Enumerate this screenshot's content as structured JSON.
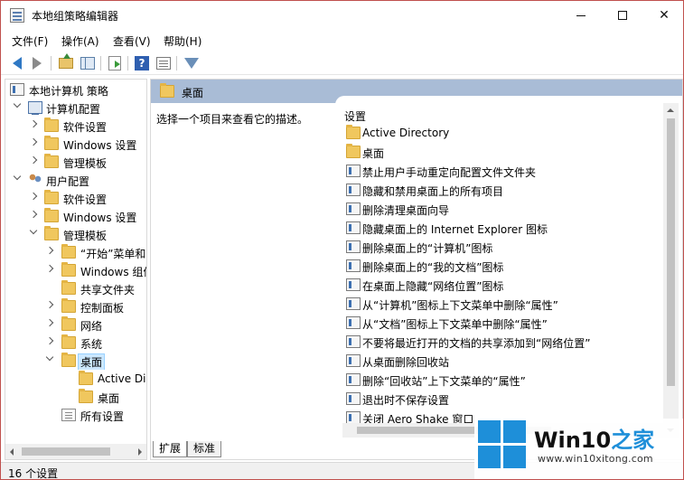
{
  "window": {
    "title": "本地组策略编辑器"
  },
  "menu": [
    "文件(F)",
    "操作(A)",
    "查看(V)",
    "帮助(H)"
  ],
  "tree": {
    "root": "本地计算机 策略",
    "computer_config": "计算机配置",
    "cc_children": [
      "软件设置",
      "Windows 设置",
      "管理模板"
    ],
    "user_config": "用户配置",
    "uc_children": [
      "软件设置",
      "Windows 设置",
      "管理模板"
    ],
    "admin_children": [
      "“开始”菜单和",
      "Windows 组件",
      "共享文件夹",
      "控制面板",
      "网络",
      "系统",
      "桌面"
    ],
    "desktop_children": [
      "Active Directory",
      "桌面"
    ],
    "all_settings": "所有设置"
  },
  "right": {
    "header_title": "桌面",
    "description": "选择一个项目来查看它的描述。",
    "column_header": "设置",
    "items": [
      {
        "type": "folder",
        "label": "Active Directory"
      },
      {
        "type": "folder",
        "label": "桌面"
      },
      {
        "type": "policy",
        "label": "禁止用户手动重定向配置文件文件夹"
      },
      {
        "type": "policy",
        "label": "隐藏和禁用桌面上的所有项目"
      },
      {
        "type": "policy",
        "label": "删除清理桌面向导"
      },
      {
        "type": "policy",
        "label": "隐藏桌面上的 Internet Explorer 图标"
      },
      {
        "type": "policy",
        "label": "删除桌面上的“计算机”图标"
      },
      {
        "type": "policy",
        "label": "删除桌面上的“我的文档”图标"
      },
      {
        "type": "policy",
        "label": "在桌面上隐藏“网络位置”图标"
      },
      {
        "type": "policy",
        "label": "从“计算机”图标上下文菜单中删除“属性”"
      },
      {
        "type": "policy",
        "label": "从“文档”图标上下文菜单中删除“属性”"
      },
      {
        "type": "policy",
        "label": "不要将最近打开的文档的共享添加到“网络位置”"
      },
      {
        "type": "policy",
        "label": "从桌面删除回收站"
      },
      {
        "type": "policy",
        "label": "删除“回收站”上下文菜单的“属性”"
      },
      {
        "type": "policy",
        "label": "退出时不保存设置"
      },
      {
        "type": "policy",
        "label": "关闭 Aero Shake 窗口"
      }
    ],
    "tabs": [
      "扩展",
      "标准"
    ]
  },
  "status": {
    "text": "16 个设置"
  },
  "watermark": {
    "title_a": "Win10",
    "title_b": "之家",
    "url": "www.win10xitong.com"
  },
  "colors": {
    "header": "#a9bcd6",
    "selection": "#cce8ff",
    "folder": "#f0c75e",
    "logo": "#1e8fd9"
  }
}
